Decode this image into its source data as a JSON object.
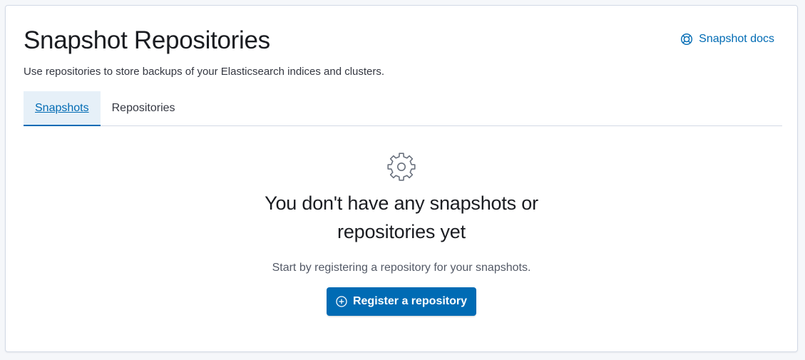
{
  "header": {
    "title": "Snapshot Repositories",
    "subtitle": "Use repositories to store backups of your Elasticsearch indices and clusters.",
    "docs_link": {
      "label": "Snapshot docs",
      "icon": "help-icon"
    }
  },
  "tabs": [
    {
      "label": "Snapshots",
      "active": true
    },
    {
      "label": "Repositories",
      "active": false
    }
  ],
  "empty_state": {
    "icon": "gear-icon",
    "title": "You don't have any snapshots or repositories yet",
    "body": "Start by registering a repository for your snapshots.",
    "button": {
      "label": "Register a repository",
      "icon": "plus-in-circle-icon"
    }
  },
  "colors": {
    "accent": "#006bb4",
    "active_tab_bg": "#e6f0f8",
    "border": "#d3dae6",
    "page_bg": "#f5f7fa"
  }
}
